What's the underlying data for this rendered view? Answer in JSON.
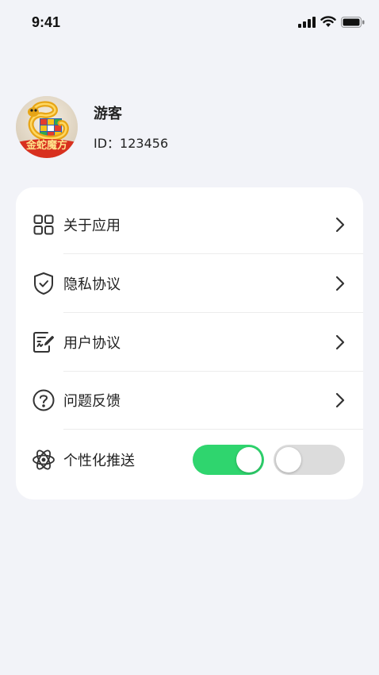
{
  "status_bar": {
    "time": "9:41",
    "icons": [
      "signal-icon",
      "wifi-icon",
      "battery-icon"
    ]
  },
  "profile": {
    "name": "游客",
    "id_text": "ID：123456",
    "avatar_text": "金蛇魔方"
  },
  "menu": {
    "items": [
      {
        "label": "关于应用",
        "icon": "grid-icon"
      },
      {
        "label": "隐私协议",
        "icon": "shield-check-icon"
      },
      {
        "label": "用户协议",
        "icon": "document-edit-icon"
      },
      {
        "label": "问题反馈",
        "icon": "question-circle-icon"
      }
    ],
    "push": {
      "label": "个性化推送",
      "icon": "atom-icon",
      "toggle_on": true,
      "toggle_off": false
    }
  },
  "colors": {
    "background": "#f2f3f8",
    "card": "#ffffff",
    "toggle_on": "#2fd56e",
    "toggle_off": "#dcdcdc"
  }
}
